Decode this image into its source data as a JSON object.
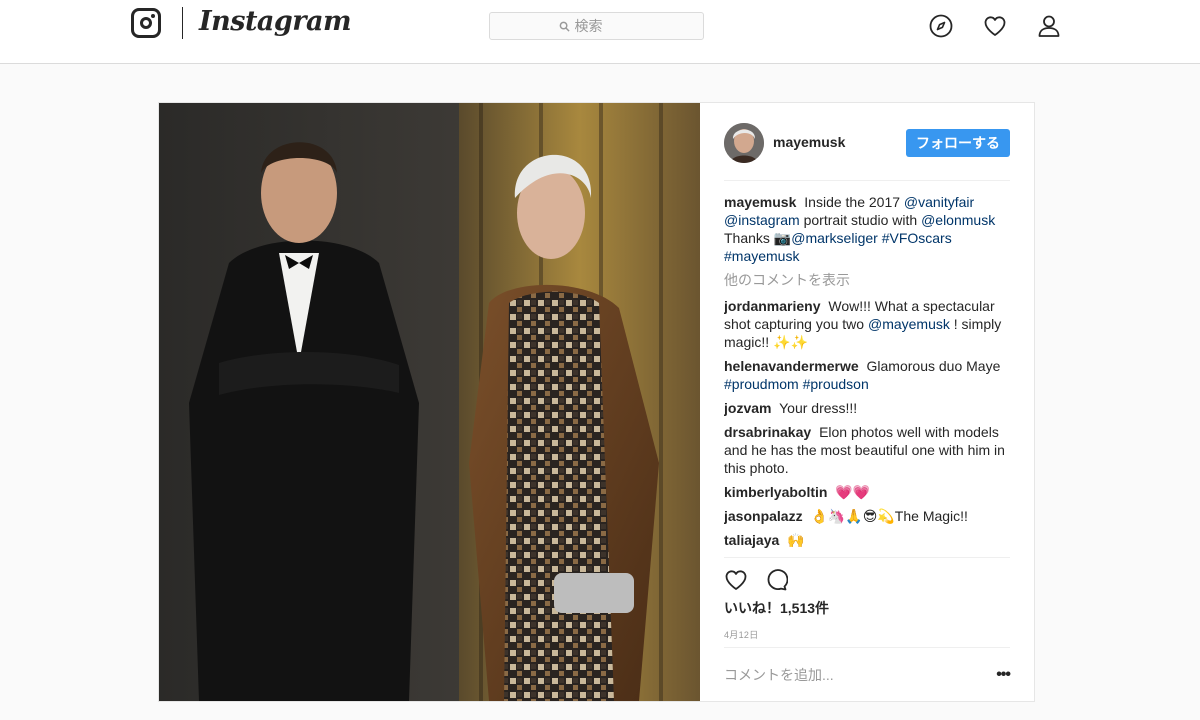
{
  "header": {
    "wordmark": "Instagram",
    "search_placeholder": "検索",
    "icons": [
      "instagram-glyph-icon",
      "compass-icon",
      "heart-icon",
      "user-icon"
    ]
  },
  "post": {
    "author": "mayemusk",
    "follow_label": "フォローする",
    "caption": {
      "user": "mayemusk",
      "pre": "Inside the 2017",
      "tag1": "@vanityfair",
      "tag2": "@instagram",
      "mid": "portrait studio with",
      "tag3": "@elonmusk",
      "thanks": "Thanks 📷",
      "tag4": "@markseliger",
      "tag5": "#VFOscars",
      "tag6": "#mayemusk"
    },
    "view_more": "他のコメントを表示",
    "comments": [
      {
        "user": "jordanmarieny",
        "pre": "Wow!!! What a spectacular shot capturing you two",
        "mention": "@mayemusk",
        "post": "! simply magic!! ✨✨"
      },
      {
        "user": "helenavandermerwe",
        "text": "Glamorous duo Maye",
        "tag1": "#proudmom",
        "tag2": "#proudson"
      },
      {
        "user": "jozvam",
        "text": "Your dress!!!"
      },
      {
        "user": "drsabrinakay",
        "text": "Elon photos well with models and he has the most beautiful one with him in this photo."
      },
      {
        "user": "kimberlyaboltin",
        "text": "💗💗"
      },
      {
        "user": "jasonpalazz",
        "text": "👌🦄🙏😎💫The Magic!!"
      },
      {
        "user": "taliajaya",
        "text": "🙌"
      }
    ],
    "likes": "いいね！1,513件",
    "date": "4月12日",
    "add_comment_placeholder": "コメントを追加...",
    "more_options": "•••",
    "accent_color": "#3897f0",
    "link_color": "#003569"
  }
}
